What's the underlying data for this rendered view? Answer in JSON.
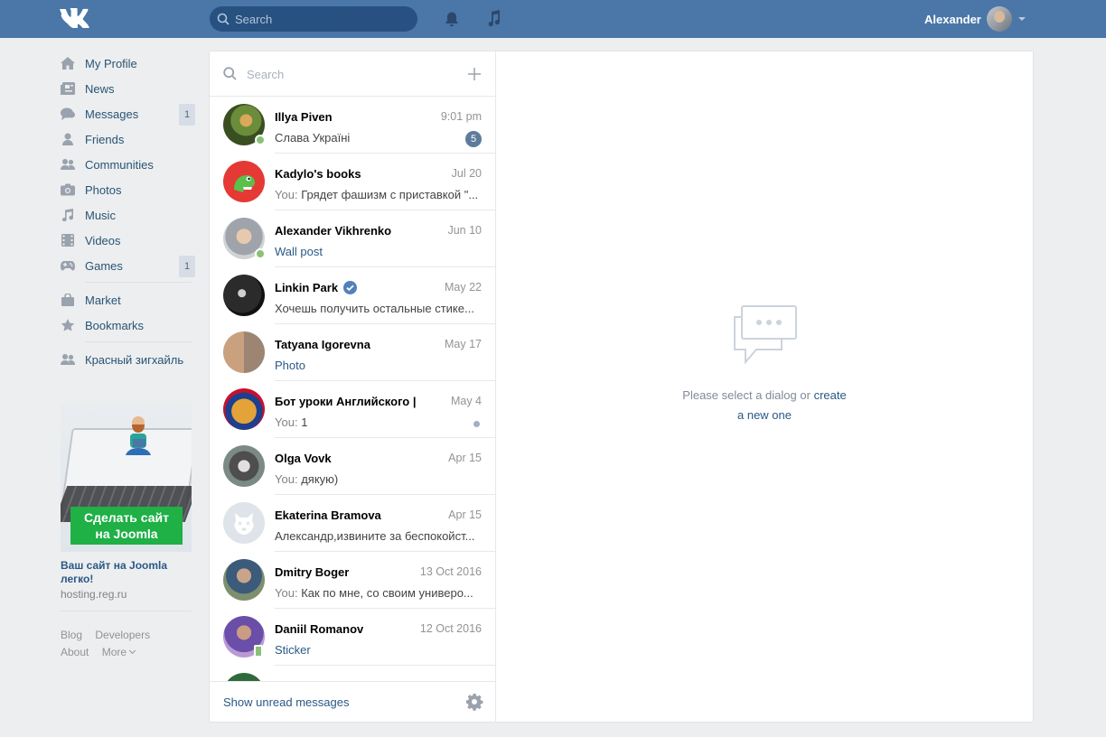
{
  "header": {
    "search_placeholder": "Search",
    "user_name": "Alexander"
  },
  "nav": {
    "items": [
      {
        "label": "My Profile",
        "icon": "home-icon"
      },
      {
        "label": "News",
        "icon": "news-icon"
      },
      {
        "label": "Messages",
        "icon": "messages-icon",
        "count": "1"
      },
      {
        "label": "Friends",
        "icon": "friends-icon"
      },
      {
        "label": "Communities",
        "icon": "communities-icon"
      },
      {
        "label": "Photos",
        "icon": "camera-icon"
      },
      {
        "label": "Music",
        "icon": "music-icon"
      },
      {
        "label": "Videos",
        "icon": "video-icon"
      },
      {
        "label": "Games",
        "icon": "gamepad-icon",
        "count": "1"
      },
      {
        "label": "Market",
        "icon": "bag-icon"
      },
      {
        "label": "Bookmarks",
        "icon": "star-icon"
      },
      {
        "label": "Красный зигхайль",
        "icon": "group-icon"
      }
    ]
  },
  "ad": {
    "banner_line1": "Сделать сайт",
    "banner_line2": "на Joomla",
    "title": "Ваш сайт на Joomla легко!",
    "domain": "hosting.reg.ru"
  },
  "footer": {
    "blog": "Blog",
    "developers": "Developers",
    "about": "About",
    "more": "More"
  },
  "dialogs": {
    "search_placeholder": "Search",
    "items": [
      {
        "name": "Illya Piven",
        "date": "9:01 pm",
        "message": "Слава Україні",
        "badge": "5"
      },
      {
        "name": "Kadylo's books",
        "date": "Jul 20",
        "you": "You:",
        "message": "Грядет фашизм с приставкой \"..."
      },
      {
        "name": "Alexander Vikhrenko",
        "date": "Jun 10",
        "message": "Wall post"
      },
      {
        "name": "Linkin Park",
        "date": "May 22",
        "message": "Хочешь получить остальные стике..."
      },
      {
        "name": "Tatyana Igorevna",
        "date": "May 17",
        "message": "Photo"
      },
      {
        "name": "Бот уроки Английского | ...",
        "date": "May 4",
        "you": "You:",
        "message": "1"
      },
      {
        "name": "Olga Vovk",
        "date": "Apr 15",
        "you": "You:",
        "message": "дякую)"
      },
      {
        "name": "Ekaterina Bramova",
        "date": "Apr 15",
        "message": "Александр,извините за беспокойст..."
      },
      {
        "name": "Dmitry Boger",
        "date": "13 Oct 2016",
        "you": "You:",
        "message": "Как по мне, со своим универо..."
      },
      {
        "name": "Daniil Romanov",
        "date": "12 Oct 2016",
        "message": "Sticker"
      }
    ],
    "show_unread": "Show unread messages"
  },
  "empty_state": {
    "text": "Please select a dialog or",
    "link_line1": "create",
    "link_line2": "a new one"
  }
}
